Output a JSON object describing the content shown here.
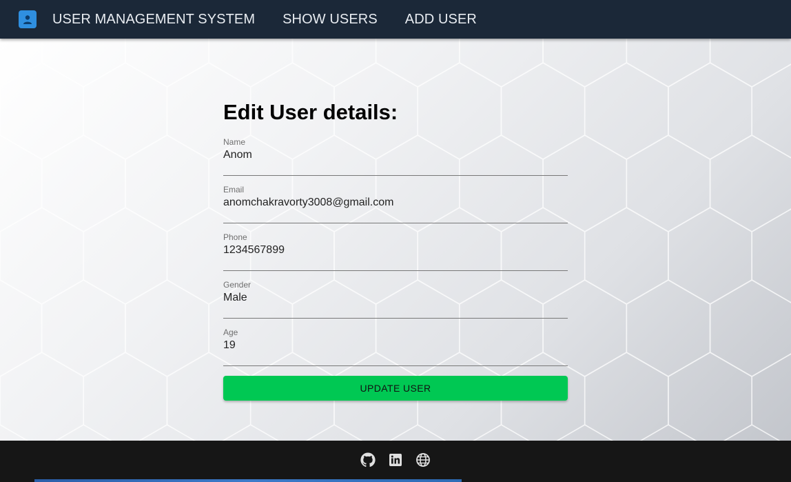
{
  "nav": {
    "logo_icon": "user-management-logo-icon",
    "title": "USER MANAGEMENT SYSTEM",
    "links": [
      "SHOW USERS",
      "ADD USER"
    ]
  },
  "form": {
    "heading": "Edit User details:",
    "fields": [
      {
        "label": "Name",
        "value": "Anom"
      },
      {
        "label": "Email",
        "value": "anomchakravorty3008@gmail.com"
      },
      {
        "label": "Phone",
        "value": "1234567899"
      },
      {
        "label": "Gender",
        "value": "Male"
      },
      {
        "label": "Age",
        "value": "19"
      }
    ],
    "submit_label": "UPDATE USER"
  },
  "footer": {
    "icons": [
      "github-icon",
      "linkedin-icon",
      "globe-icon"
    ]
  },
  "colors": {
    "navbar": "#1b2838",
    "accent_button": "#00c853",
    "footer": "#161616"
  }
}
